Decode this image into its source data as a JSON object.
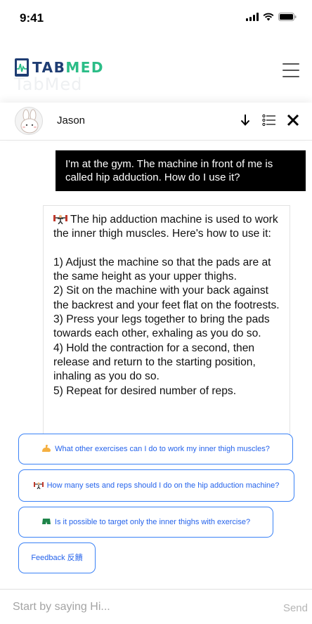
{
  "status_bar": {
    "time": "9:41"
  },
  "app": {
    "logo_part1": "TAB",
    "logo_part2": "MED",
    "logo_ghost": "TabMed",
    "brand_color_primary": "#1f3d73",
    "brand_color_accent": "#2bbd87"
  },
  "chat_header": {
    "name": "Jason",
    "actions": [
      "arrow-down-icon",
      "list-icon",
      "close-icon"
    ]
  },
  "messages": {
    "user": "I'm at the gym. The machine  in front of me is called hip adduction. How do I use it?",
    "bot": " The hip adduction machine is used to work the inner thigh muscles. Here's how to use it:\n\n1) Adjust the machine so that the pads are at the same height as your upper thighs.\n2) Sit on the machine with your back against the backrest and your feet flat on the footrests.\n3) Press your legs together to bring the pads towards each other, exhaling as you do so.\n4) Hold the contraction for a second, then release and return to the starting position, inhaling as you do so.\n5) Repeat for desired number of reps."
  },
  "suggestions": [
    "What other exercises can I do to work my inner thigh muscles?",
    "How many sets and reps should I do on the hip adduction machine?",
    "Is it possible to target only the inner thighs with exercise?",
    "Feedback 反饋"
  ],
  "input": {
    "placeholder": "Start by saying Hi...",
    "send_label": "Send"
  },
  "colors": {
    "suggestion_border": "#3b82f6",
    "suggestion_text": "#2563eb"
  }
}
